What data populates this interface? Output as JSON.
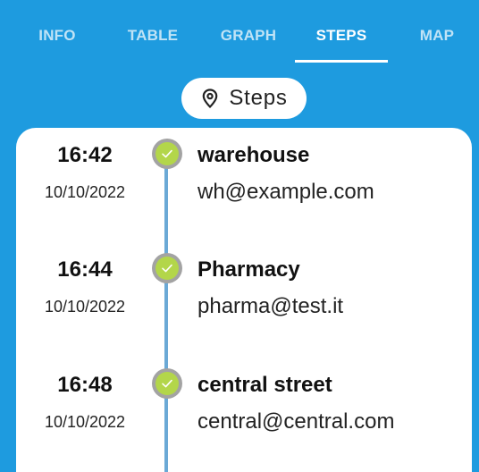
{
  "tabs": [
    {
      "label": "INFO",
      "active": false
    },
    {
      "label": "TABLE",
      "active": false
    },
    {
      "label": "GRAPH",
      "active": false
    },
    {
      "label": "STEPS",
      "active": true
    },
    {
      "label": "MAP",
      "active": false
    }
  ],
  "chip": {
    "label": "Steps",
    "icon": "map-pin-icon"
  },
  "steps": [
    {
      "time": "16:42",
      "date": "10/10/2022",
      "name": "warehouse",
      "email": "wh@example.com",
      "status": "completed"
    },
    {
      "time": "16:44",
      "date": "10/10/2022",
      "name": "Pharmacy",
      "email": "pharma@test.it",
      "status": "completed"
    },
    {
      "time": "16:48",
      "date": "10/10/2022",
      "name": "central street",
      "email": "central@central.com",
      "status": "completed"
    }
  ],
  "colors": {
    "header": "#1e9bdf",
    "timeline": "#6ba9d6",
    "check": "#b3d64a",
    "check_ring": "#a3a3a3"
  }
}
